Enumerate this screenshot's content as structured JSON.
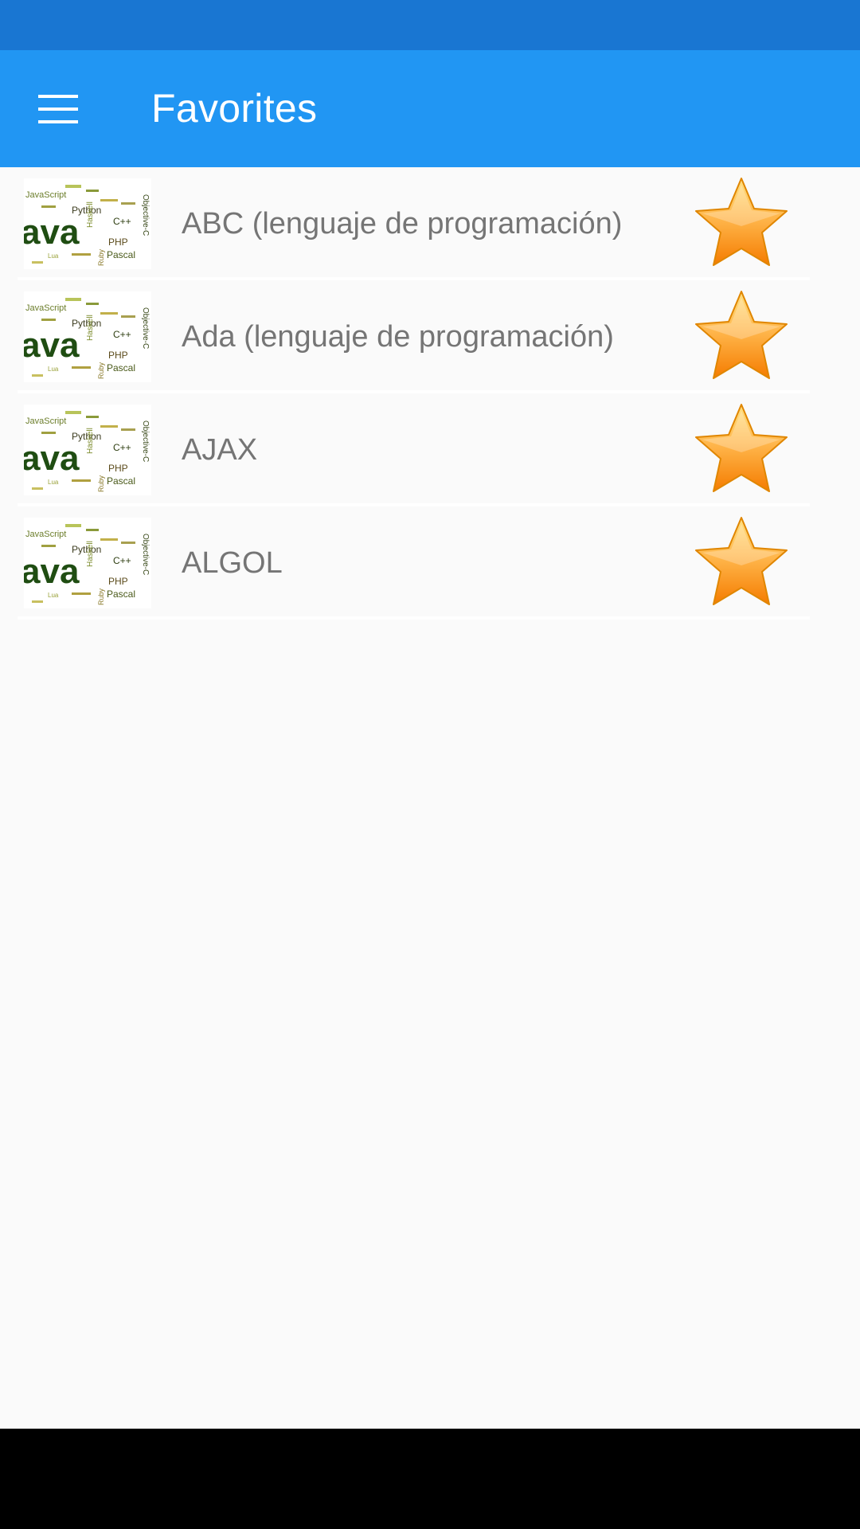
{
  "app_bar": {
    "title": "Favorites",
    "menu_icon": "hamburger-menu-icon"
  },
  "colors": {
    "status_bar": "#1976d2",
    "app_bar": "#2196f3",
    "star_fill": "#ffa726",
    "background": "#fafafa"
  },
  "favorites": [
    {
      "label": "ABC (lenguaje de programación)",
      "thumbnail": "programming-languages-word-cloud",
      "starred": true
    },
    {
      "label": "Ada (lenguaje de programación)",
      "thumbnail": "programming-languages-word-cloud",
      "starred": true
    },
    {
      "label": "AJAX",
      "thumbnail": "programming-languages-word-cloud",
      "starred": true
    },
    {
      "label": "ALGOL",
      "thumbnail": "programming-languages-word-cloud",
      "starred": true
    }
  ],
  "thumbnail_words": [
    "ava",
    "Python",
    "PHP",
    "Pascal",
    "C++",
    "Haskell",
    "Ruby",
    "Objective-C",
    "JavaScript",
    "Lua"
  ]
}
